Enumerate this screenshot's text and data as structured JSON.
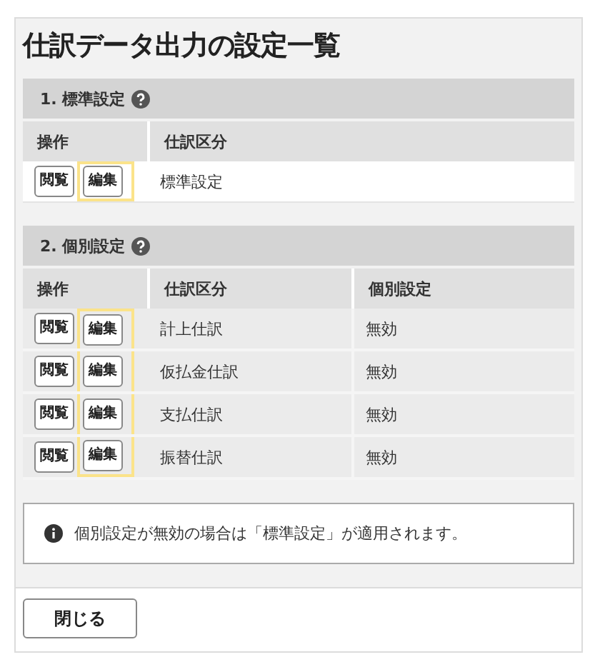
{
  "title": "仕訳データ出力の設定一覧",
  "sections": [
    {
      "heading": "1. 標準設定",
      "help": true,
      "highlight_edit_column": true,
      "columns": [
        "操作",
        "仕訳区分"
      ],
      "rows": [
        {
          "cells": [
            {
              "kind": "actions",
              "buttons": [
                "閲覧",
                "編集"
              ]
            },
            {
              "kind": "text",
              "text": "標準設定"
            }
          ]
        }
      ]
    },
    {
      "heading": "2. 個別設定",
      "help": true,
      "highlight_edit_column": true,
      "columns": [
        "操作",
        "仕訳区分",
        "個別設定"
      ],
      "rows": [
        {
          "cells": [
            {
              "kind": "actions",
              "buttons": [
                "閲覧",
                "編集"
              ]
            },
            {
              "kind": "text",
              "text": "計上仕訳"
            },
            {
              "kind": "text",
              "text": "無効"
            }
          ]
        },
        {
          "cells": [
            {
              "kind": "actions",
              "buttons": [
                "閲覧",
                "編集"
              ]
            },
            {
              "kind": "text",
              "text": "仮払金仕訳"
            },
            {
              "kind": "text",
              "text": "無効"
            }
          ]
        },
        {
          "cells": [
            {
              "kind": "actions",
              "buttons": [
                "閲覧",
                "編集"
              ]
            },
            {
              "kind": "text",
              "text": "支払仕訳"
            },
            {
              "kind": "text",
              "text": "無効"
            }
          ]
        },
        {
          "cells": [
            {
              "kind": "actions",
              "buttons": [
                "閲覧",
                "編集"
              ]
            },
            {
              "kind": "text",
              "text": "振替仕訳"
            },
            {
              "kind": "text",
              "text": "無効"
            }
          ]
        }
      ]
    }
  ],
  "notice": "個別設定が無効の場合は「標準設定」が適用されます。",
  "close_button": "閉じる"
}
